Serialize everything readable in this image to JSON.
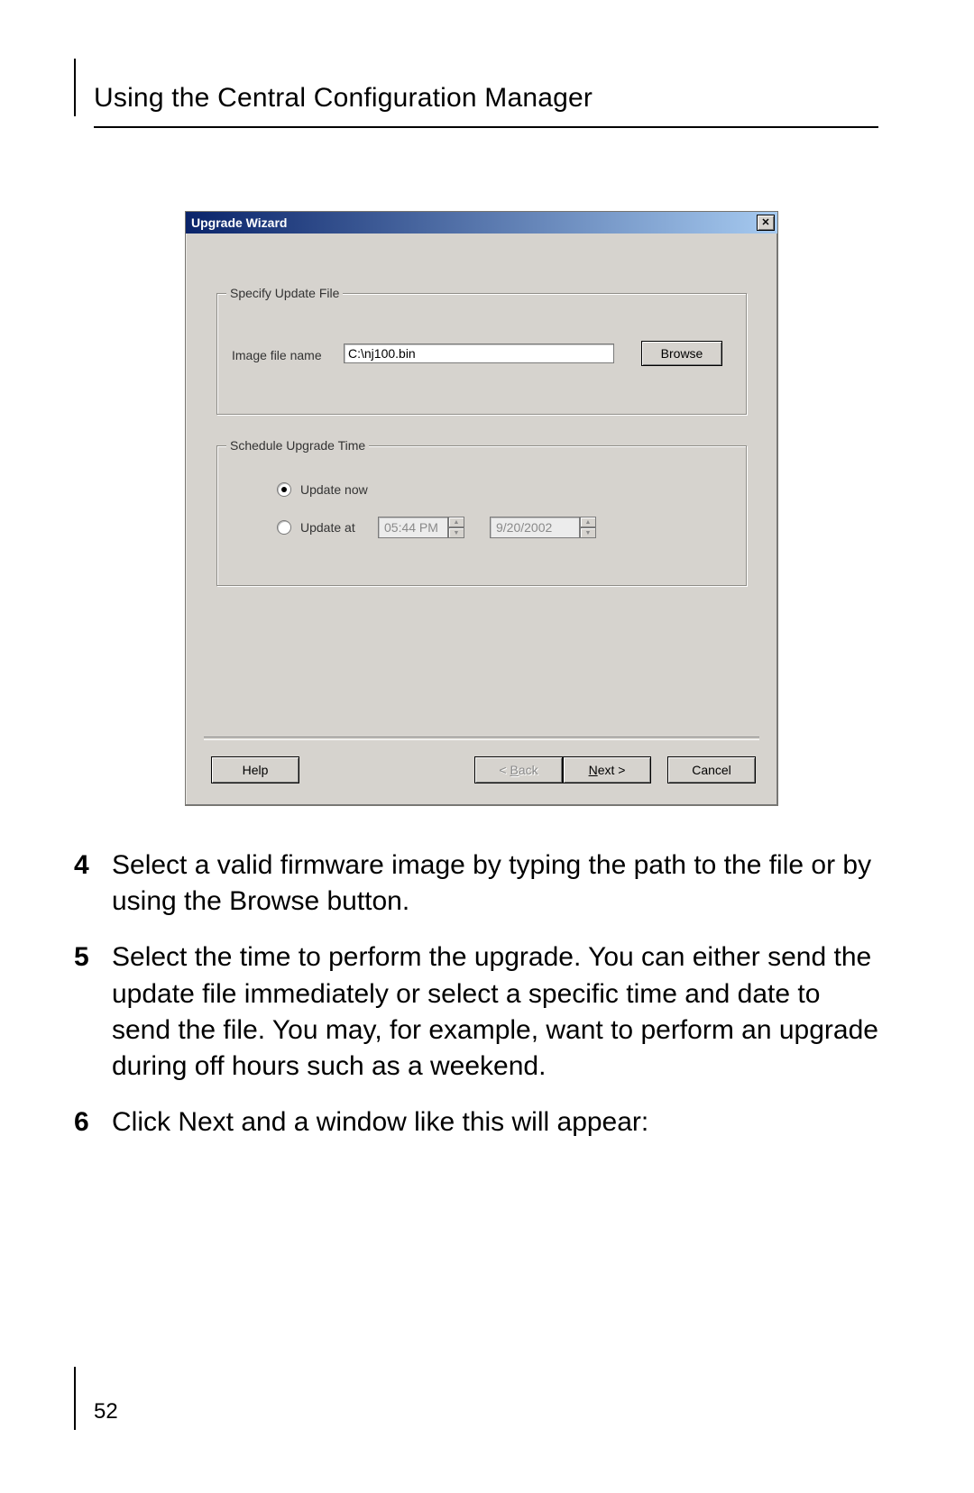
{
  "header": {
    "chapter_title": "Using the Central Configuration Manager"
  },
  "page_number": "52",
  "dialog": {
    "title": "Upgrade Wizard",
    "close_glyph": "✕",
    "file_group": {
      "legend": "Specify Update File",
      "label": "Image file name",
      "value": "C:\\nj100.bin",
      "browse": "Browse"
    },
    "schedule_group": {
      "legend": "Schedule Upgrade Time",
      "update_now": "Update now",
      "update_at": "Update at",
      "time": "05:44 PM",
      "date": "9/20/2002"
    },
    "buttons": {
      "help": "Help",
      "back": "< Back",
      "next": "Next >",
      "cancel": "Cancel"
    }
  },
  "steps": {
    "s4_num": "4",
    "s4_text": "Select a valid firmware image by typing the path to the file or by using the Browse button.",
    "s5_num": "5",
    "s5_text": "Select the time to perform the upgrade. You can either send the update file immediately or select a specific time and date to send the file. You may, for example, want to perform an upgrade during off hours such as a weekend.",
    "s6_num": "6",
    "s6_text": "Click Next and a window like this will appear:"
  }
}
